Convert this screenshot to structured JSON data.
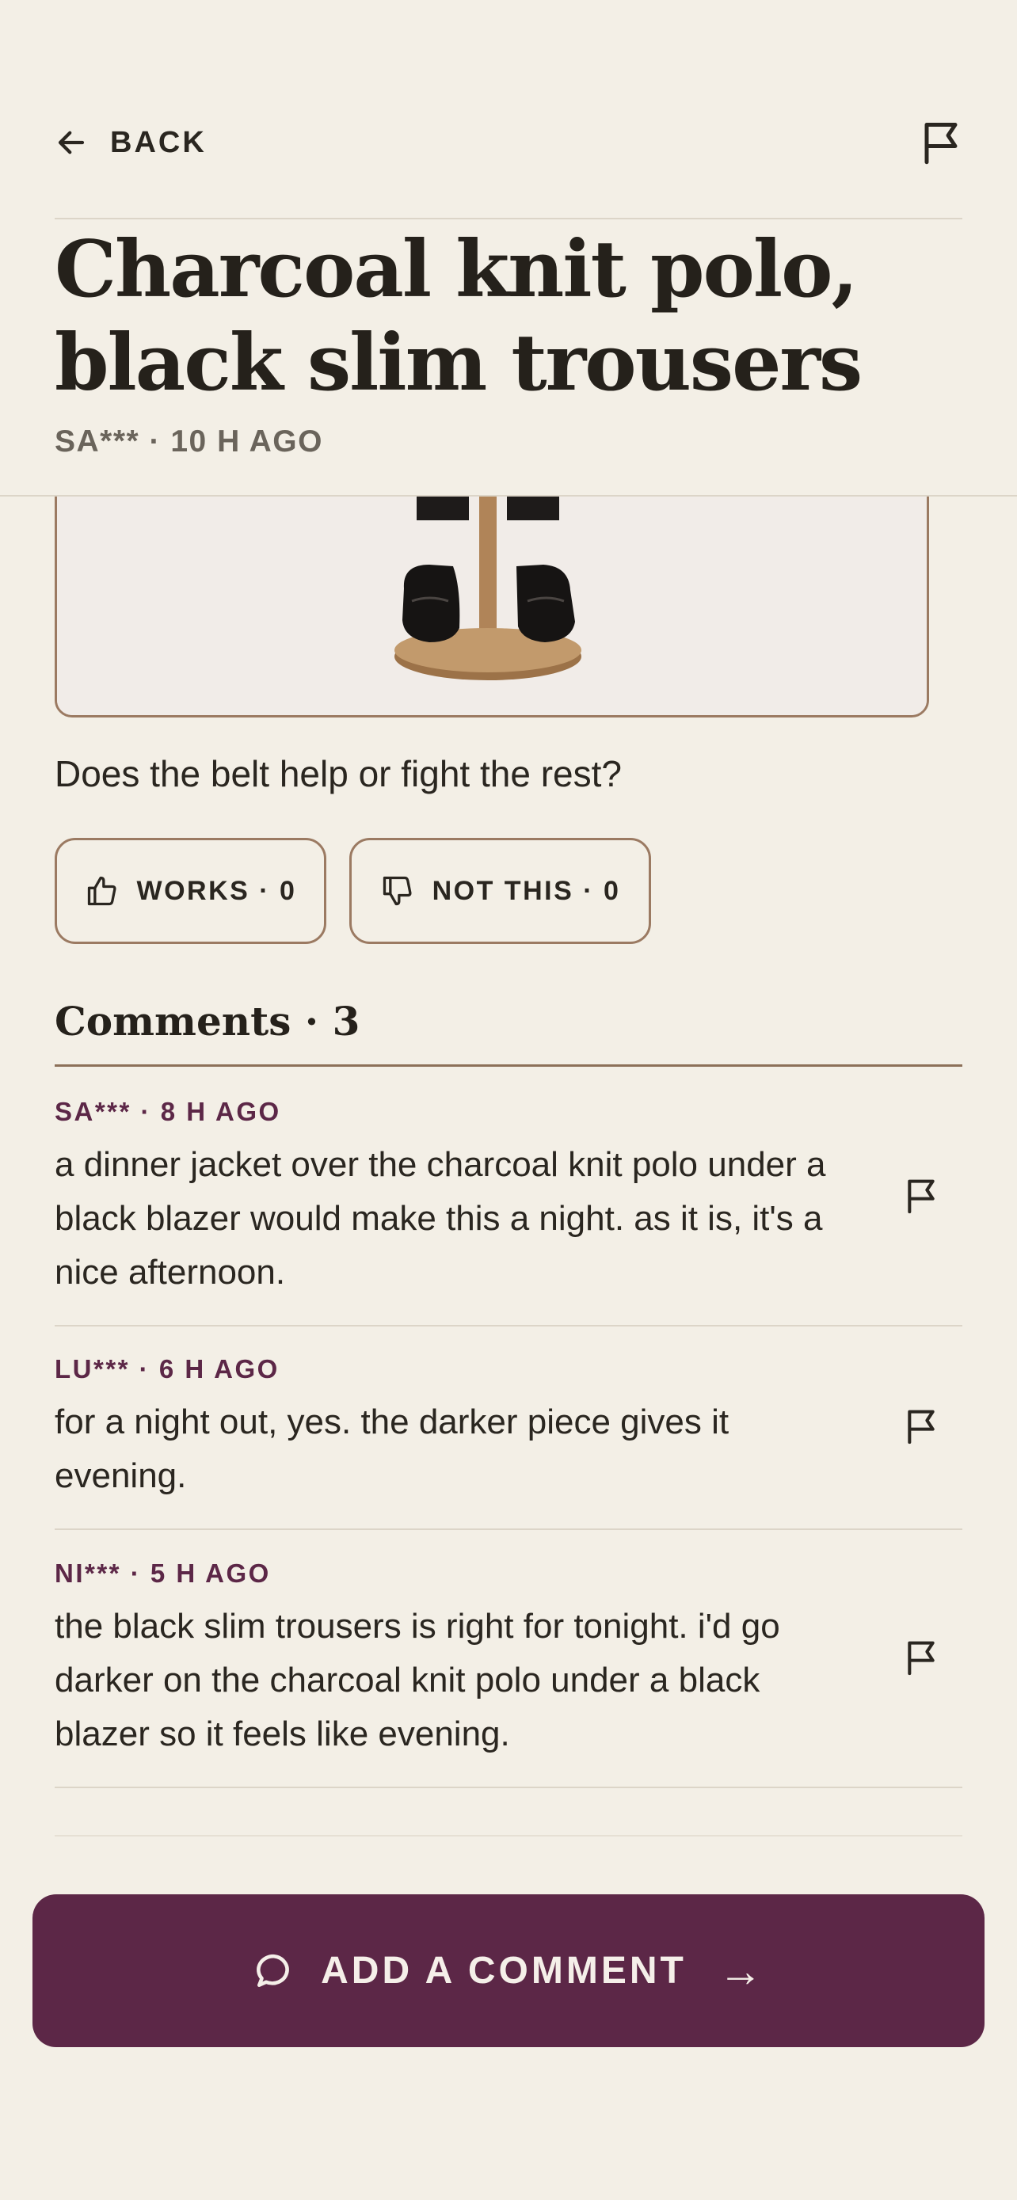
{
  "header": {
    "back_label": "BACK",
    "title": "Charcoal knit polo, black slim trousers",
    "meta": "SA*** · 10 H AGO"
  },
  "post": {
    "question": "Does the belt help or fight the rest?",
    "works_label": "WORKS · 0",
    "not_this_label": "NOT THIS · 0"
  },
  "comments": {
    "heading": "Comments · 3",
    "items": [
      {
        "meta": "SA*** · 8 H AGO",
        "text": "a dinner jacket over the charcoal knit polo under a black blazer would make this a night. as it is, it's a nice afternoon."
      },
      {
        "meta": "LU*** · 6 H AGO",
        "text": "for a night out, yes. the darker piece gives it evening."
      },
      {
        "meta": "NI*** · 5 H AGO",
        "text": "the black slim trousers is right for tonight. i'd go darker on the charcoal knit polo under a black blazer so it feels like evening."
      }
    ]
  },
  "cta": {
    "label": "ADD A COMMENT",
    "arrow": "→"
  },
  "colors": {
    "background": "#f3efe6",
    "accent": "#5c2747",
    "border": "#9b7a62",
    "text": "#2a2620"
  },
  "icons": {
    "back": "arrow-left-icon",
    "report": "flag-icon",
    "works": "thumbs-up-icon",
    "not_this": "thumbs-down-icon",
    "comment": "speech-bubble-icon"
  }
}
